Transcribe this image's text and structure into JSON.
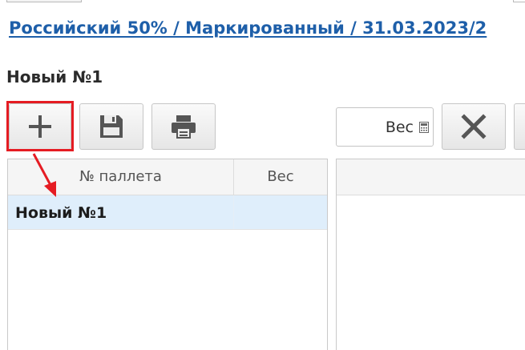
{
  "breadcrumb": {
    "link_text": "Российский 50% / Маркированный / 31.03.2023/2"
  },
  "document": {
    "title": "Новый №1"
  },
  "toolbar": {
    "add_icon": "plus-icon",
    "save_icon": "floppy-disk-icon",
    "print_icon": "printer-icon",
    "delete_icon": "close-icon"
  },
  "weight_input": {
    "placeholder": "Вес",
    "icon": "calculator-icon"
  },
  "pallets_table": {
    "columns": [
      "№ паллета",
      "Вес"
    ],
    "rows": [
      {
        "pallet": "Новый №1",
        "weight": "",
        "selected": true
      }
    ]
  },
  "colors": {
    "link": "#1e5fa9",
    "highlight": "#e51c23",
    "selected_row": "#dfeefb",
    "icon": "#555555"
  }
}
